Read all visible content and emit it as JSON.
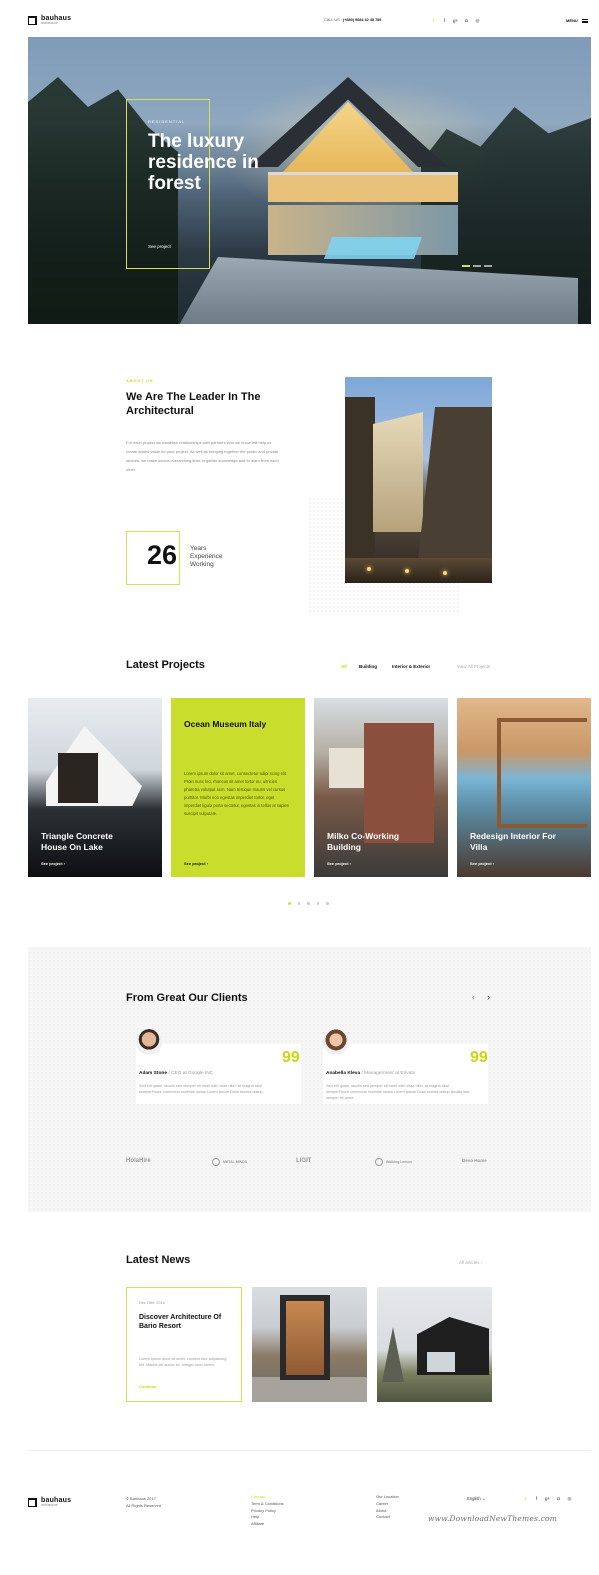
{
  "header": {
    "logo_name": "bauhaus",
    "logo_tag": "architecture",
    "call_label": "CALL US",
    "phone": "(+880) 9684 32 45 789",
    "social_icons": [
      "twitter-icon",
      "facebook-icon",
      "google-plus-icon",
      "instagram-icon",
      "dribbble-icon"
    ],
    "social_glyphs": [
      "t",
      "f",
      "g+",
      "◘",
      "◎"
    ],
    "menu_label": "MENU"
  },
  "hero": {
    "kicker": "RESIDENTIAL",
    "title": "The luxury residence in forest",
    "link": "See project"
  },
  "about": {
    "kicker": "ABOUT US",
    "title": "We Are The Leader In The Architectural",
    "paragraph": "For each project we establish relationships with partners who we know will help us create added value for your project. As well as bringing together the public and private sectors, we make sector-overarching links to gather knowledge and to learn from each other.",
    "years_number": "26",
    "years_label": "Years Experience Working"
  },
  "projects": {
    "title": "Latest Projects",
    "filters": [
      "All",
      "Building",
      "Interior & Exterior",
      "View All Projects"
    ],
    "cards": [
      {
        "title": "Triangle Concrete House On Lake",
        "link": "See project ›"
      },
      {
        "title": "Ocean Museum Italy",
        "text": "Lorem ipsum dolor sit amet, consectetur adipi scing elit. Proin nunc leo, rhoncus sit amet tortor eu, ultricies pharetra volutpat sem. Nam tristique mauris vel cursus porttitor. Morbi non egestas imperdiet tortor, eget imperdiet ligula porta sectetur, egestas in tellus at sapien suscipit vulputate.",
        "link": "See project ›"
      },
      {
        "title": "Milko Co-Working Building",
        "link": "See project ›"
      },
      {
        "title": "Redesign Interior For Villa",
        "link": "See project ›"
      }
    ]
  },
  "testimonials": {
    "title": "From Great Our Clients",
    "prev": "‹",
    "next": "›",
    "items": [
      {
        "name": "Adam Stone",
        "role": " / CEO at Google INC",
        "text": "Sed elit quam, iaculis sed semper sit amet udin vitae nibh. at magna akal semperFusce commodo molestie luctus Lorem ipsum Dolor tusima olatup."
      },
      {
        "name": "Anabella Kleva",
        "role": " / Managerment at Envato",
        "text": "Sed elit quam, iaculis sed semper sit amet udin vitae nibh. at magna akal semperFusce commodo molestie luctus Lorem ipsum Dolor tusima olatup iacullis sed semper sit amet."
      }
    ],
    "brands": [
      "HolaHire",
      "METAL MINDS",
      "LIGIT",
      "Walking Lemon",
      "Devo Home"
    ],
    "quote_mark": "99"
  },
  "news": {
    "title": "Latest News",
    "all_link": "All articles  ›",
    "date": "Dec 15th, 2016",
    "headline": "Discover Architecture Of Bario Resort",
    "text": "Lorem ipsum dolor sit amet, consect etur adipisicing elit. Mauris vel auctor ex. Integer nunc lorem.",
    "link": "Continue"
  },
  "footer": {
    "logo_name": "bauhaus",
    "logo_tag": "architecture",
    "copyright_1": "© Bauhaus 2017",
    "copyright_2": "All Rights Reserved",
    "col1": [
      "Contact",
      "Term & Conditions",
      "Privacy Policy",
      "Help",
      "Affiliate"
    ],
    "col2": [
      "Our Location",
      "Career",
      "About",
      "Contact"
    ],
    "language": "English  ⌄",
    "social_glyphs": [
      "t",
      "f",
      "g+",
      "◘",
      "◎"
    ],
    "watermark": "www.DownloadNewThemes.com"
  },
  "colors": {
    "accent": "#d4e157",
    "accent_dark": "#c9d90f",
    "text": "#111111",
    "muted": "#999999"
  }
}
